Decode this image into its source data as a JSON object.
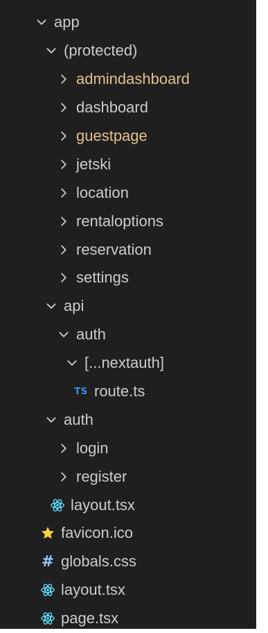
{
  "explorer": {
    "items": [
      {
        "label": "app",
        "depth": 0,
        "kind": "folder-open",
        "color": "#cccccc"
      },
      {
        "label": "(protected)",
        "depth": 1,
        "kind": "folder-open",
        "color": "#cccccc"
      },
      {
        "label": "admindashboard",
        "depth": 2,
        "kind": "folder-closed",
        "color": "#e2c08d"
      },
      {
        "label": "dashboard",
        "depth": 2,
        "kind": "folder-closed",
        "color": "#cccccc"
      },
      {
        "label": "guestpage",
        "depth": 2,
        "kind": "folder-closed",
        "color": "#e2c08d"
      },
      {
        "label": "jetski",
        "depth": 2,
        "kind": "folder-closed",
        "color": "#cccccc"
      },
      {
        "label": "location",
        "depth": 2,
        "kind": "folder-closed",
        "color": "#cccccc"
      },
      {
        "label": "rentaloptions",
        "depth": 2,
        "kind": "folder-closed",
        "color": "#cccccc"
      },
      {
        "label": "reservation",
        "depth": 2,
        "kind": "folder-closed",
        "color": "#cccccc"
      },
      {
        "label": "settings",
        "depth": 2,
        "kind": "folder-closed",
        "color": "#cccccc"
      },
      {
        "label": "api",
        "depth": 1,
        "kind": "folder-open",
        "color": "#cccccc"
      },
      {
        "label": "auth",
        "depth": 2,
        "kind": "folder-open",
        "color": "#cccccc"
      },
      {
        "label": "[...nextauth]",
        "depth": 3,
        "kind": "folder-open",
        "color": "#cccccc"
      },
      {
        "label": "route.ts",
        "depth": 4,
        "kind": "file-ts",
        "icon": "typescript-icon",
        "icon_text": "TS",
        "color": "#cccccc"
      },
      {
        "label": "auth",
        "depth": 1,
        "kind": "folder-open",
        "color": "#cccccc"
      },
      {
        "label": "login",
        "depth": 2,
        "kind": "folder-closed",
        "color": "#cccccc"
      },
      {
        "label": "register",
        "depth": 2,
        "kind": "folder-closed",
        "color": "#cccccc"
      },
      {
        "label": "layout.tsx",
        "depth": 2,
        "kind": "file-react",
        "icon": "react-icon",
        "color": "#cccccc"
      },
      {
        "label": "favicon.ico",
        "depth": 0,
        "kind": "file-star",
        "icon": "star-icon",
        "color": "#cccccc"
      },
      {
        "label": "globals.css",
        "depth": 0,
        "kind": "file-css",
        "icon": "hash-icon",
        "icon_text": "#",
        "color": "#cccccc"
      },
      {
        "label": "layout.tsx",
        "depth": 0,
        "kind": "file-react",
        "icon": "react-icon",
        "color": "#cccccc"
      },
      {
        "label": "page.tsx",
        "depth": 0,
        "kind": "file-react",
        "icon": "react-icon",
        "color": "#cccccc"
      }
    ]
  },
  "colors": {
    "background": "#1f1f1f",
    "text": "#cccccc",
    "modified": "#e2c08d",
    "ts": "#3b8eea",
    "react": "#61dafb",
    "star": "#f5d33b",
    "css": "#8fc8f5"
  }
}
